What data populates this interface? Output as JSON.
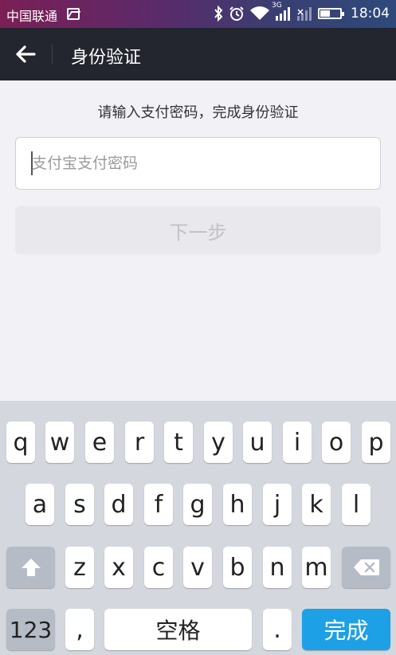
{
  "status_bar": {
    "carrier": "中国联通",
    "network_type": "3G",
    "time": "18:04",
    "icons": [
      "image-icon",
      "bluetooth-icon",
      "alarm-icon",
      "wifi-icon",
      "signal-icon",
      "no-signal-icon",
      "battery-icon"
    ]
  },
  "header": {
    "title": "身份验证",
    "background": "#23262f"
  },
  "main": {
    "prompt": "请输入支付密码，完成身份验证",
    "password_input": {
      "placeholder": "支付宝支付密码",
      "value": ""
    },
    "next_button": "下一步"
  },
  "keyboard": {
    "row1": [
      "q",
      "w",
      "e",
      "r",
      "t",
      "y",
      "u",
      "i",
      "o",
      "p"
    ],
    "row2": [
      "a",
      "s",
      "d",
      "f",
      "g",
      "h",
      "j",
      "k",
      "l"
    ],
    "row3": [
      "z",
      "x",
      "c",
      "v",
      "b",
      "n",
      "m"
    ],
    "numbers_label": "123",
    "comma": ",",
    "space_label": "空格",
    "period": ".",
    "done_label": "完成",
    "accent": "#1ea0e6"
  }
}
